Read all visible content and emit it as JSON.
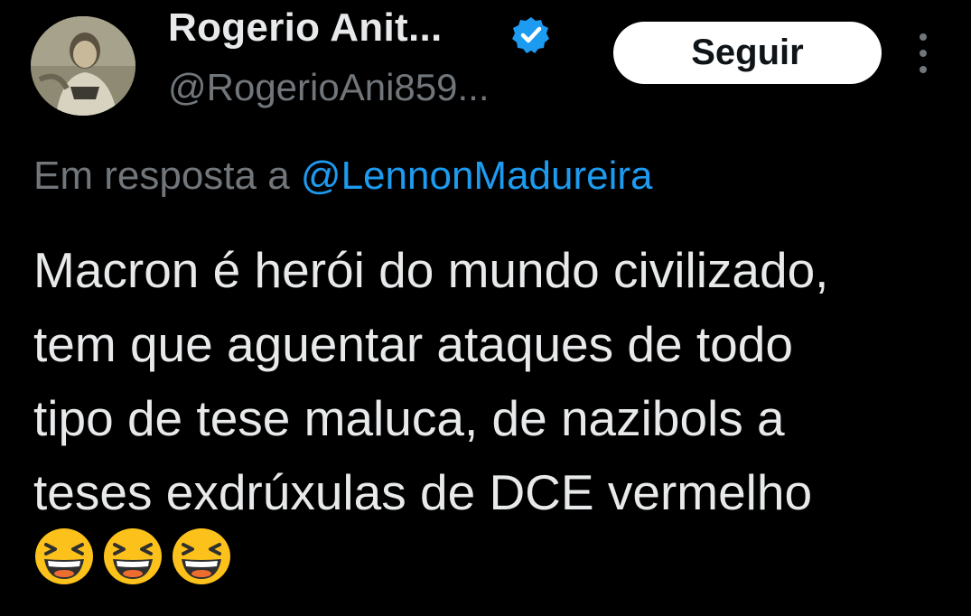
{
  "author": {
    "display_name": "Rogerio Anit...",
    "handle": "@RogerioAni859...",
    "verified_icon": "verified-badge-icon",
    "avatar": "profile-photo"
  },
  "actions": {
    "follow_label": "Seguir",
    "more_icon": "more-vertical-icon"
  },
  "reply": {
    "prefix": "Em resposta a",
    "mention": "@LennonMadureira"
  },
  "tweet": {
    "lines": [
      "Macron é herói do mundo civilizado,",
      "tem que aguentar ataques de todo",
      "tipo de tese maluca, de nazibols a",
      "teses exdrúxulas de DCE vermelho"
    ],
    "emojis": [
      "laughing-face-icon",
      "laughing-face-icon",
      "laughing-face-icon"
    ]
  },
  "colors": {
    "background": "#000000",
    "text": "#e7e9ea",
    "secondary": "#71767b",
    "link": "#1d9bf0",
    "verified": "#1d9bf0",
    "button_bg": "#ffffff"
  }
}
